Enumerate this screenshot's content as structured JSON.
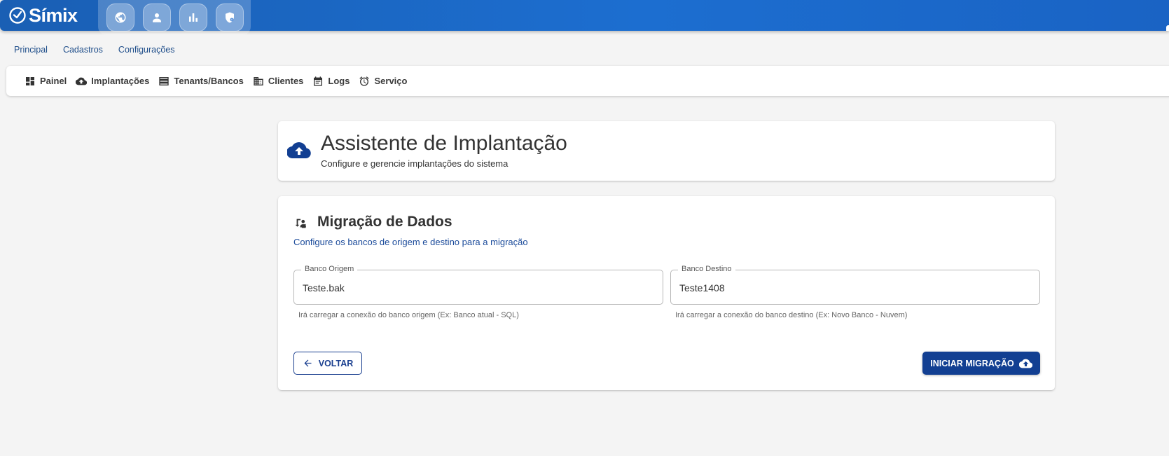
{
  "brand": {
    "name": "Símix"
  },
  "quick_actions": [
    {
      "icon": "globe-icon"
    },
    {
      "icon": "person-icon"
    },
    {
      "icon": "bar-chart-icon"
    },
    {
      "icon": "shield-icon"
    }
  ],
  "menu": {
    "items": [
      "Principal",
      "Cadastros",
      "Configurações"
    ]
  },
  "subnav": {
    "items": [
      {
        "label": "Painel",
        "icon": "dashboard-icon"
      },
      {
        "label": "Implantações",
        "icon": "cloud-upload-icon"
      },
      {
        "label": "Tenants/Bancos",
        "icon": "list-icon"
      },
      {
        "label": "Clientes",
        "icon": "building-icon"
      },
      {
        "label": "Logs",
        "icon": "calendar-icon"
      },
      {
        "label": "Serviço",
        "icon": "alarm-icon"
      }
    ]
  },
  "header": {
    "title": "Assistente de Implantação",
    "subtitle": "Configure e gerencie implantações do sistema"
  },
  "migration": {
    "title": "Migração de Dados",
    "subtitle": "Configure os bancos de origem e destino para a migração",
    "origin": {
      "label": "Banco Origem",
      "value": "Teste.bak",
      "helper": "Irá carregar a conexão do banco origem (Ex: Banco atual - SQL)"
    },
    "destination": {
      "label": "Banco Destino",
      "value": "Teste1408",
      "helper": "Irá carregar a conexão do banco destino (Ex: Novo Banco - Nuvem)"
    },
    "back_label": "VOLTAR",
    "start_label": "INICIAR MIGRAÇÃO"
  },
  "colors": {
    "primary": "#123f92",
    "topbar": "#1c6ed0",
    "link": "#1f4e8a",
    "background": "#f4f4f4"
  }
}
